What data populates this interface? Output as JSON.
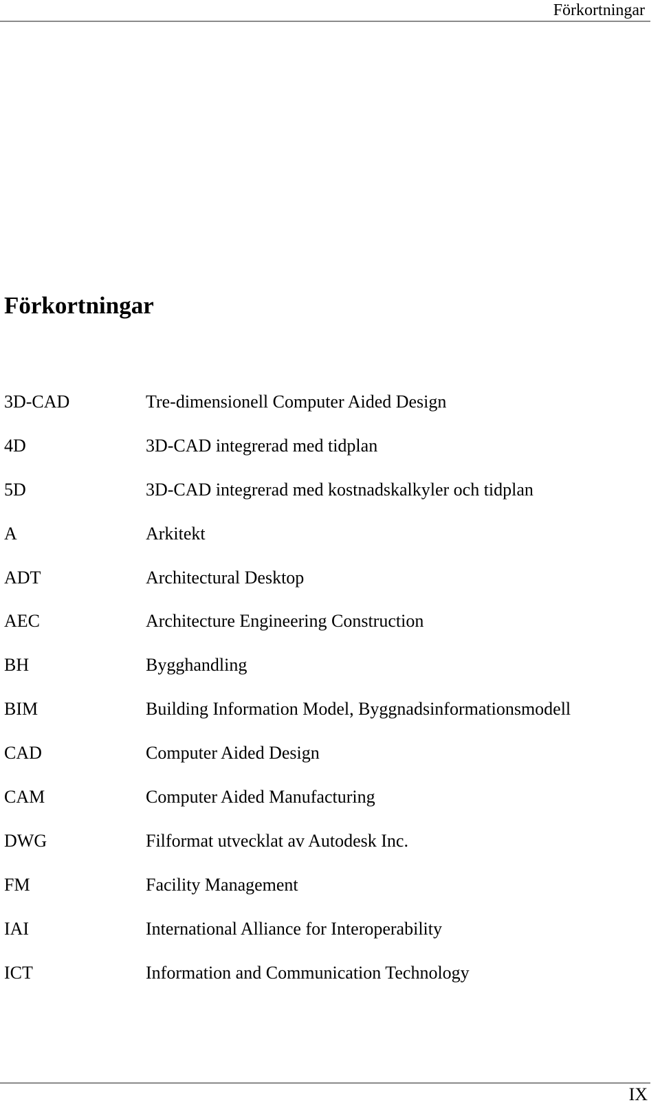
{
  "header": {
    "running_title": "Förkortningar"
  },
  "title": "Förkortningar",
  "abbreviations": [
    {
      "term": "3D-CAD",
      "definition": "Tre-dimensionell Computer Aided Design"
    },
    {
      "term": "4D",
      "definition": "3D-CAD integrerad med tidplan"
    },
    {
      "term": "5D",
      "definition": "3D-CAD integrerad med kostnadskalkyler och tidplan"
    },
    {
      "term": "A",
      "definition": "Arkitekt"
    },
    {
      "term": "ADT",
      "definition": "Architectural Desktop"
    },
    {
      "term": "AEC",
      "definition": "Architecture Engineering Construction"
    },
    {
      "term": "BH",
      "definition": "Bygghandling"
    },
    {
      "term": "BIM",
      "definition": "Building Information Model, Byggnadsinformationsmodell"
    },
    {
      "term": "CAD",
      "definition": "Computer Aided Design"
    },
    {
      "term": "CAM",
      "definition": "Computer Aided Manufacturing"
    },
    {
      "term": "DWG",
      "definition": "Filformat utvecklat av Autodesk Inc."
    },
    {
      "term": "FM",
      "definition": "Facility Management"
    },
    {
      "term": "IAI",
      "definition": "International Alliance for Interoperability"
    },
    {
      "term": "ICT",
      "definition": "Information and Communication Technology"
    }
  ],
  "footer": {
    "page_number": "IX"
  }
}
